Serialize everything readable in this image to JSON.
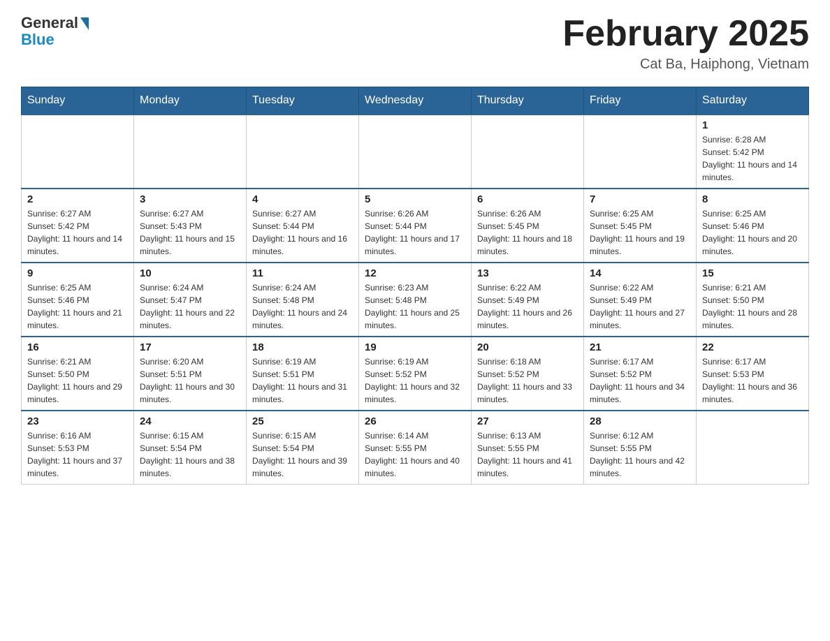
{
  "logo": {
    "general": "General",
    "blue": "Blue"
  },
  "title": "February 2025",
  "location": "Cat Ba, Haiphong, Vietnam",
  "days_of_week": [
    "Sunday",
    "Monday",
    "Tuesday",
    "Wednesday",
    "Thursday",
    "Friday",
    "Saturday"
  ],
  "weeks": [
    [
      {
        "day": "",
        "info": ""
      },
      {
        "day": "",
        "info": ""
      },
      {
        "day": "",
        "info": ""
      },
      {
        "day": "",
        "info": ""
      },
      {
        "day": "",
        "info": ""
      },
      {
        "day": "",
        "info": ""
      },
      {
        "day": "1",
        "info": "Sunrise: 6:28 AM\nSunset: 5:42 PM\nDaylight: 11 hours and 14 minutes."
      }
    ],
    [
      {
        "day": "2",
        "info": "Sunrise: 6:27 AM\nSunset: 5:42 PM\nDaylight: 11 hours and 14 minutes."
      },
      {
        "day": "3",
        "info": "Sunrise: 6:27 AM\nSunset: 5:43 PM\nDaylight: 11 hours and 15 minutes."
      },
      {
        "day": "4",
        "info": "Sunrise: 6:27 AM\nSunset: 5:44 PM\nDaylight: 11 hours and 16 minutes."
      },
      {
        "day": "5",
        "info": "Sunrise: 6:26 AM\nSunset: 5:44 PM\nDaylight: 11 hours and 17 minutes."
      },
      {
        "day": "6",
        "info": "Sunrise: 6:26 AM\nSunset: 5:45 PM\nDaylight: 11 hours and 18 minutes."
      },
      {
        "day": "7",
        "info": "Sunrise: 6:25 AM\nSunset: 5:45 PM\nDaylight: 11 hours and 19 minutes."
      },
      {
        "day": "8",
        "info": "Sunrise: 6:25 AM\nSunset: 5:46 PM\nDaylight: 11 hours and 20 minutes."
      }
    ],
    [
      {
        "day": "9",
        "info": "Sunrise: 6:25 AM\nSunset: 5:46 PM\nDaylight: 11 hours and 21 minutes."
      },
      {
        "day": "10",
        "info": "Sunrise: 6:24 AM\nSunset: 5:47 PM\nDaylight: 11 hours and 22 minutes."
      },
      {
        "day": "11",
        "info": "Sunrise: 6:24 AM\nSunset: 5:48 PM\nDaylight: 11 hours and 24 minutes."
      },
      {
        "day": "12",
        "info": "Sunrise: 6:23 AM\nSunset: 5:48 PM\nDaylight: 11 hours and 25 minutes."
      },
      {
        "day": "13",
        "info": "Sunrise: 6:22 AM\nSunset: 5:49 PM\nDaylight: 11 hours and 26 minutes."
      },
      {
        "day": "14",
        "info": "Sunrise: 6:22 AM\nSunset: 5:49 PM\nDaylight: 11 hours and 27 minutes."
      },
      {
        "day": "15",
        "info": "Sunrise: 6:21 AM\nSunset: 5:50 PM\nDaylight: 11 hours and 28 minutes."
      }
    ],
    [
      {
        "day": "16",
        "info": "Sunrise: 6:21 AM\nSunset: 5:50 PM\nDaylight: 11 hours and 29 minutes."
      },
      {
        "day": "17",
        "info": "Sunrise: 6:20 AM\nSunset: 5:51 PM\nDaylight: 11 hours and 30 minutes."
      },
      {
        "day": "18",
        "info": "Sunrise: 6:19 AM\nSunset: 5:51 PM\nDaylight: 11 hours and 31 minutes."
      },
      {
        "day": "19",
        "info": "Sunrise: 6:19 AM\nSunset: 5:52 PM\nDaylight: 11 hours and 32 minutes."
      },
      {
        "day": "20",
        "info": "Sunrise: 6:18 AM\nSunset: 5:52 PM\nDaylight: 11 hours and 33 minutes."
      },
      {
        "day": "21",
        "info": "Sunrise: 6:17 AM\nSunset: 5:52 PM\nDaylight: 11 hours and 34 minutes."
      },
      {
        "day": "22",
        "info": "Sunrise: 6:17 AM\nSunset: 5:53 PM\nDaylight: 11 hours and 36 minutes."
      }
    ],
    [
      {
        "day": "23",
        "info": "Sunrise: 6:16 AM\nSunset: 5:53 PM\nDaylight: 11 hours and 37 minutes."
      },
      {
        "day": "24",
        "info": "Sunrise: 6:15 AM\nSunset: 5:54 PM\nDaylight: 11 hours and 38 minutes."
      },
      {
        "day": "25",
        "info": "Sunrise: 6:15 AM\nSunset: 5:54 PM\nDaylight: 11 hours and 39 minutes."
      },
      {
        "day": "26",
        "info": "Sunrise: 6:14 AM\nSunset: 5:55 PM\nDaylight: 11 hours and 40 minutes."
      },
      {
        "day": "27",
        "info": "Sunrise: 6:13 AM\nSunset: 5:55 PM\nDaylight: 11 hours and 41 minutes."
      },
      {
        "day": "28",
        "info": "Sunrise: 6:12 AM\nSunset: 5:55 PM\nDaylight: 11 hours and 42 minutes."
      },
      {
        "day": "",
        "info": ""
      }
    ]
  ]
}
